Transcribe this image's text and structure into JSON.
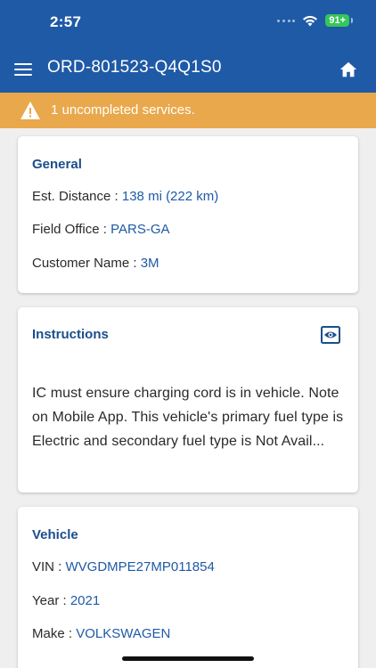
{
  "status": {
    "time": "2:57",
    "battery": "91+"
  },
  "header": {
    "title": "ORD-801523-Q4Q1S0"
  },
  "banner": {
    "text": "1 uncompleted services."
  },
  "general": {
    "title": "General",
    "distance_label": "Est. Distance : ",
    "distance_value": "138 mi (222 km)",
    "office_label": "Field Office : ",
    "office_value": "PARS-GA",
    "customer_label": "Customer Name : ",
    "customer_value": "3M"
  },
  "instructions": {
    "title": "Instructions",
    "text": "IC must ensure charging cord is in vehicle. Note on Mobile App. This vehicle's primary fuel type is Electric and secondary fuel type is  Not Avail..."
  },
  "vehicle": {
    "title": "Vehicle",
    "vin_label": "VIN : ",
    "vin_value": "WVGDMPE27MP011854",
    "year_label": "Year : ",
    "year_value": "2021",
    "make_label": "Make : ",
    "make_value": "VOLKSWAGEN"
  }
}
